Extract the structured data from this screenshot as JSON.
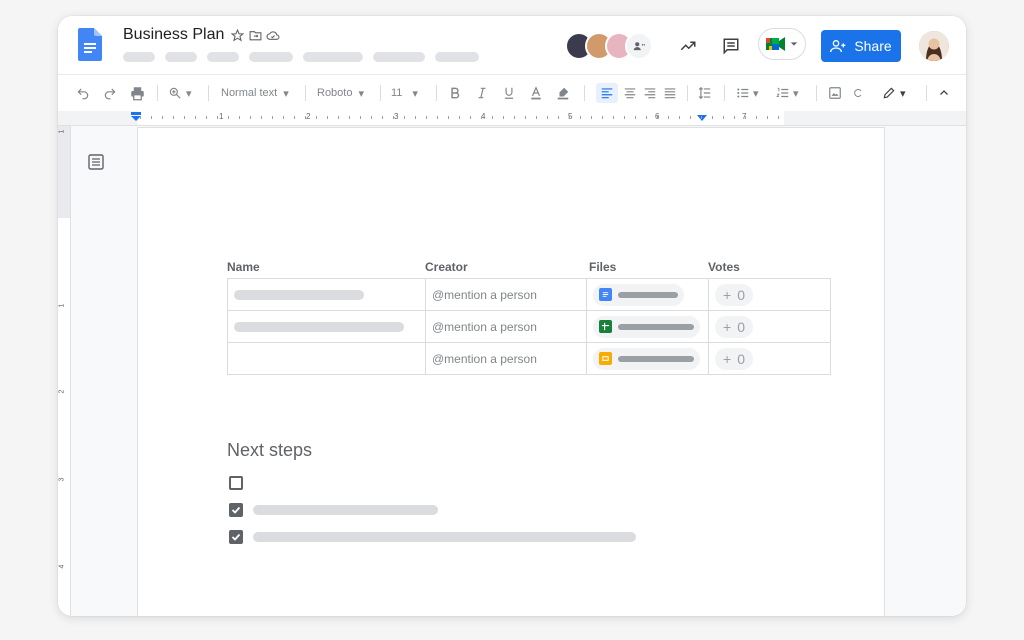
{
  "document": {
    "title": "Business Plan"
  },
  "icons": {
    "star": "star-icon",
    "move": "folder-move-icon",
    "cloud": "cloud-saved-icon",
    "activity": "trending-up-icon",
    "comments": "comment-icon",
    "meet": "google-meet-icon",
    "share": "person-add-icon"
  },
  "share_label": "Share",
  "toolbar": {
    "style_label": "Normal text",
    "font_label": "Roboto",
    "size_label": "11"
  },
  "ruler": {
    "numbers": [
      "1",
      "2",
      "3",
      "4",
      "5",
      "6",
      "7"
    ]
  },
  "vruler": {
    "numbers": [
      "1",
      "1",
      "2",
      "3",
      "4"
    ]
  },
  "table": {
    "headers": [
      "Name",
      "Creator",
      "Files",
      "Votes"
    ],
    "rows": [
      {
        "creator": "@mention a person",
        "file_type": "docs",
        "vote_plus": "+",
        "votes": "0"
      },
      {
        "creator": "@mention a person",
        "file_type": "sheets",
        "vote_plus": "+",
        "votes": "0"
      },
      {
        "creator": "@mention a person",
        "file_type": "slides",
        "vote_plus": "+",
        "votes": "0"
      }
    ]
  },
  "next_steps": {
    "title": "Next steps",
    "items": [
      {
        "checked": false
      },
      {
        "checked": true
      },
      {
        "checked": true
      }
    ]
  },
  "colors": {
    "accent": "#1a73e8",
    "docs_blue": "#4285f4",
    "sheets_green": "#188038",
    "slides_yellow": "#fbbc04"
  }
}
